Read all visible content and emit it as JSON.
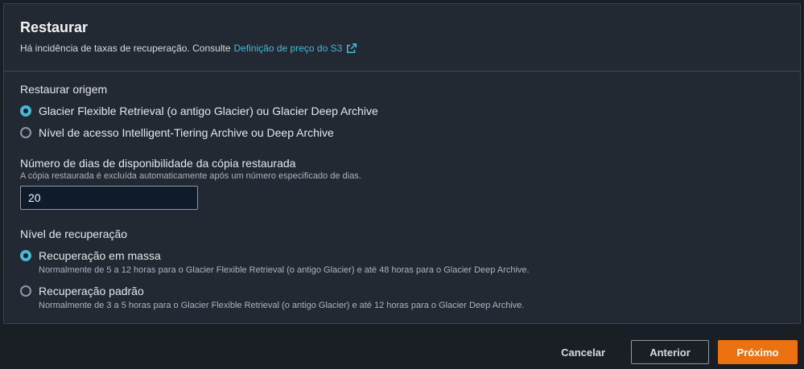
{
  "panel": {
    "title": "Restaurar",
    "subtitle_text": "Há incidência de taxas de recuperação. Consulte",
    "subtitle_link": "Definição de preço do S3"
  },
  "origin": {
    "label": "Restaurar origem",
    "options": [
      {
        "label": "Glacier Flexible Retrieval (o antigo Glacier) ou Glacier Deep Archive",
        "checked": true
      },
      {
        "label": "Nível de acesso Intelligent-Tiering Archive ou Deep Archive",
        "checked": false
      }
    ]
  },
  "days": {
    "label": "Número de dias de disponibilidade da cópia restaurada",
    "description": "A cópia restaurada é excluída automaticamente após um número especificado de dias.",
    "value": "20"
  },
  "level": {
    "label": "Nível de recuperação",
    "options": [
      {
        "label": "Recuperação em massa",
        "description": "Normalmente de 5 a 12 horas para o Glacier Flexible Retrieval (o antigo Glacier) e até 48 horas para o Glacier Deep Archive.",
        "checked": true
      },
      {
        "label": "Recuperação padrão",
        "description": "Normalmente de 3 a 5 horas para o Glacier Flexible Retrieval (o antigo Glacier) e até 12 horas para o Glacier Deep Archive.",
        "checked": false
      }
    ]
  },
  "footer": {
    "cancel": "Cancelar",
    "previous": "Anterior",
    "next": "Próximo"
  },
  "colors": {
    "accent": "#44b9d6",
    "primary": "#ec7211",
    "panel_bg": "#232932",
    "page_bg": "#1a1f26"
  },
  "icons": {
    "external_link": "external-link-icon"
  }
}
